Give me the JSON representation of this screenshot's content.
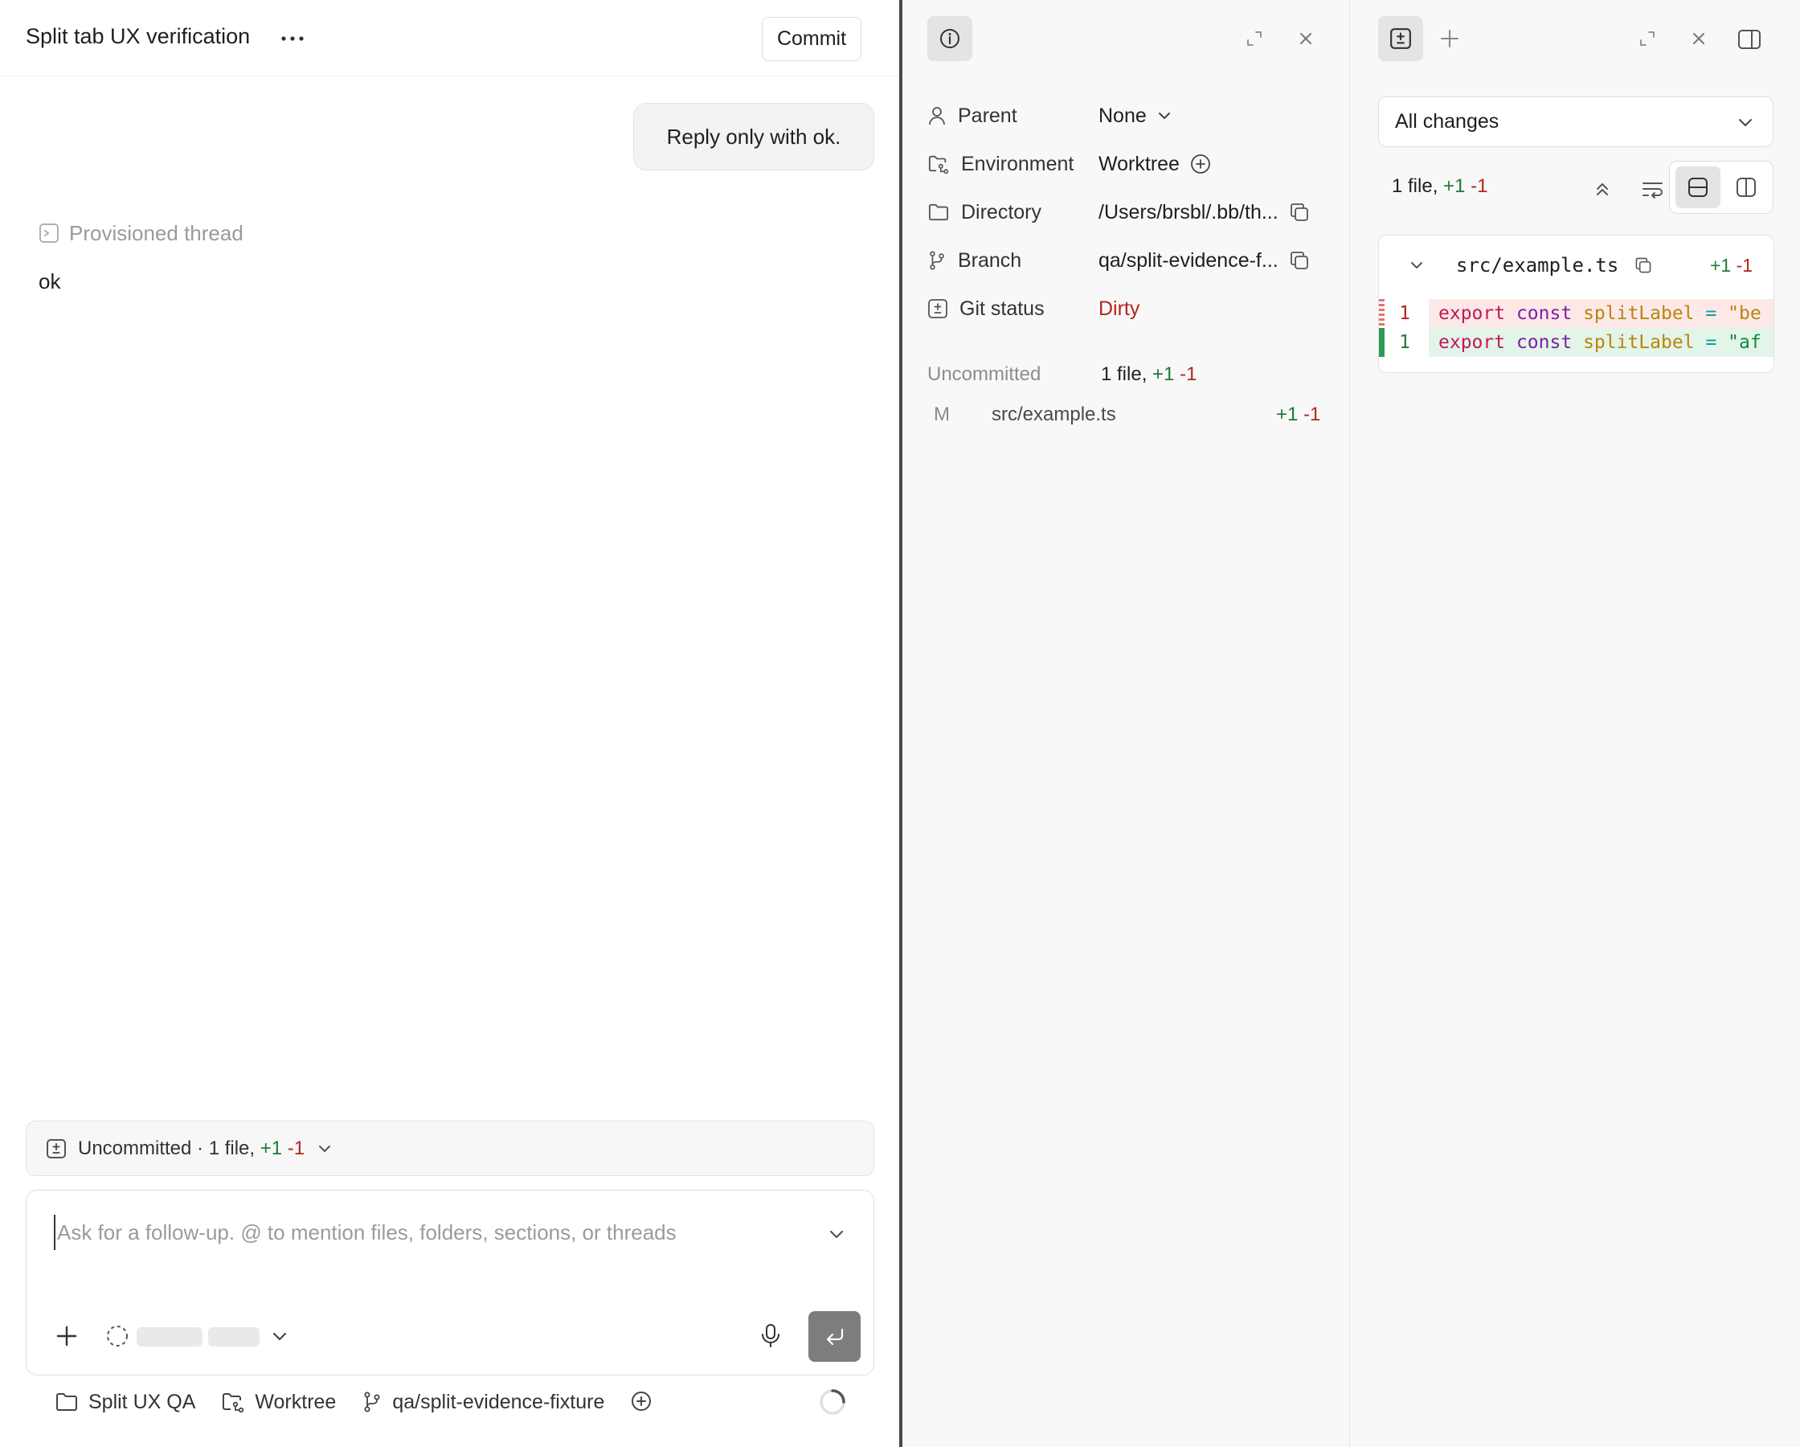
{
  "left": {
    "thread_title": "Split tab UX verification",
    "more_label": "···",
    "commit_label": "Commit",
    "user_message": "Reply only with ok.",
    "provisioned_label": "Provisioned thread",
    "assistant_reply": "ok",
    "uncommitted_bar": {
      "prefix": "Uncommitted · 1 file,",
      "added": "+1",
      "removed": "-1"
    },
    "composer": {
      "placeholder": "Ask for a follow-up. @ to mention files, folders, sections, or threads"
    },
    "footer": {
      "project": "Split UX QA",
      "environment": "Worktree",
      "branch": "qa/split-evidence-fixture"
    }
  },
  "middle": {
    "properties": [
      {
        "label": "Parent",
        "value": "None",
        "icon": "person-icon"
      },
      {
        "label": "Environment",
        "value": "Worktree",
        "icon": "worktree-icon"
      },
      {
        "label": "Directory",
        "value": "/Users/brsbl/.bb/th...",
        "icon": "folder-icon"
      },
      {
        "label": "Branch",
        "value": "qa/split-evidence-f...",
        "icon": "branch-icon"
      },
      {
        "label": "Git status",
        "value": "Dirty",
        "icon": "diff-icon"
      }
    ],
    "uncommitted": {
      "label": "Uncommitted",
      "summary_prefix": "1 file,",
      "added": "+1",
      "removed": "-1"
    },
    "files": [
      {
        "status": "M",
        "name": "src/example.ts",
        "added": "+1",
        "removed": "-1"
      }
    ]
  },
  "right": {
    "filter_value": "All changes",
    "summary_prefix": "1 file,",
    "added": "+1",
    "removed": "-1",
    "diff_file": {
      "name": "src/example.ts",
      "added": "+1",
      "removed": "-1",
      "lines": [
        {
          "kind": "removed",
          "num": "1",
          "kw": "export",
          "kw2": "const",
          "id": "splitLabel",
          "op": "=",
          "str": "\"be"
        },
        {
          "kind": "added",
          "num": "1",
          "kw": "export",
          "kw2": "const",
          "id": "splitLabel",
          "op": "=",
          "str": "\"af"
        }
      ]
    }
  },
  "colors": {
    "added": "#1f7a3a",
    "removed": "#b3261e",
    "dirty": "#b3261e",
    "removed_line_bg": "#fde8e8",
    "added_line_bg": "#e3f4e8",
    "removed_bar": "#e57373",
    "added_bar": "#2e9a55"
  }
}
